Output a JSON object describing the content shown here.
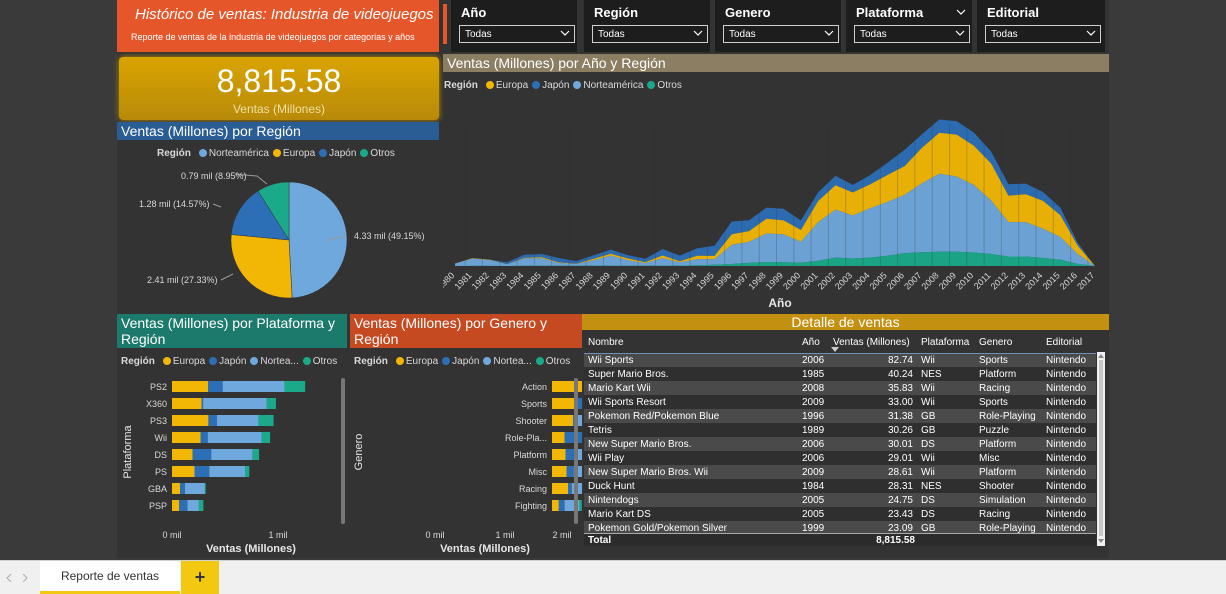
{
  "header": {
    "title": "Histórico de ventas: Industria de videojuegos",
    "subtitle": "Reporte de ventas de la industria de videojuegos por categorias y años"
  },
  "kpi": {
    "value": "8,815.58",
    "label": "Ventas (Millones)"
  },
  "slicers": [
    {
      "label": "Año",
      "value": "Todas"
    },
    {
      "label": "Región",
      "value": "Todas"
    },
    {
      "label": "Genero",
      "value": "Todas"
    },
    {
      "label": "Plataforma",
      "value": "Todas"
    },
    {
      "label": "Editorial",
      "value": "Todas"
    }
  ],
  "colors": {
    "Europa": "#f2b705",
    "Japón": "#2c6fb7",
    "Norteamérica": "#6fa8dc",
    "Otros": "#1aaa8a"
  },
  "pie": {
    "title": "Ventas (Millones) por Región",
    "legend_title": "Región",
    "legend": [
      "Norteamérica",
      "Europa",
      "Japón",
      "Otros"
    ],
    "labels": [
      "4.33 mil (49.15%)",
      "2.41 mil (27.33%)",
      "1.28 mil (14.57%)",
      "0.79 mil (8.95%)"
    ]
  },
  "area": {
    "title": "Ventas (Millones) por Año y Región",
    "legend_title": "Región",
    "legend": [
      "Europa",
      "Japón",
      "Norteamérica",
      "Otros"
    ],
    "xlabel": "Año"
  },
  "platform": {
    "title": "Ventas (Millones) por Plataforma y Región",
    "legend_title": "Región",
    "legend": [
      "Europa",
      "Japón",
      "Nortea...",
      "Otros"
    ],
    "ylabel": "Plataforma",
    "xlabel": "Ventas (Millones)",
    "ticks": [
      "0 mil",
      "1 mil"
    ]
  },
  "genre": {
    "title": "Ventas (Millones) por Genero y Región",
    "legend_title": "Región",
    "legend": [
      "Europa",
      "Japón",
      "Nortea...",
      "Otros"
    ],
    "ylabel": "Genero",
    "xlabel": "Ventas (Millones)",
    "ticks": [
      "0 mil",
      "1 mil",
      "2 mil"
    ]
  },
  "detail": {
    "title": "Detalle de ventas",
    "columns": [
      "Nombre",
      "Año",
      "Ventas (Millones)",
      "Plataforma",
      "Genero",
      "Editorial"
    ],
    "rows": [
      [
        "Wii Sports",
        "2006",
        "82.74",
        "Wii",
        "Sports",
        "Nintendo"
      ],
      [
        "Super Mario Bros.",
        "1985",
        "40.24",
        "NES",
        "Platform",
        "Nintendo"
      ],
      [
        "Mario Kart Wii",
        "2008",
        "35.83",
        "Wii",
        "Racing",
        "Nintendo"
      ],
      [
        "Wii Sports Resort",
        "2009",
        "33.00",
        "Wii",
        "Sports",
        "Nintendo"
      ],
      [
        "Pokemon Red/Pokemon Blue",
        "1996",
        "31.38",
        "GB",
        "Role-Playing",
        "Nintendo"
      ],
      [
        "Tetris",
        "1989",
        "30.26",
        "GB",
        "Puzzle",
        "Nintendo"
      ],
      [
        "New Super Mario Bros.",
        "2006",
        "30.01",
        "DS",
        "Platform",
        "Nintendo"
      ],
      [
        "Wii Play",
        "2006",
        "29.01",
        "Wii",
        "Misc",
        "Nintendo"
      ],
      [
        "New Super Mario Bros. Wii",
        "2009",
        "28.61",
        "Wii",
        "Platform",
        "Nintendo"
      ],
      [
        "Duck Hunt",
        "1984",
        "28.31",
        "NES",
        "Shooter",
        "Nintendo"
      ],
      [
        "Nintendogs",
        "2005",
        "24.75",
        "DS",
        "Simulation",
        "Nintendo"
      ],
      [
        "Mario Kart DS",
        "2005",
        "23.43",
        "DS",
        "Racing",
        "Nintendo"
      ],
      [
        "Pokemon Gold/Pokemon Silver",
        "1999",
        "23.09",
        "GB",
        "Role-Playing",
        "Nintendo"
      ]
    ],
    "total_label": "Total",
    "total_value": "8,815.58"
  },
  "tabs": {
    "active": "Reporte de ventas",
    "add": "+"
  },
  "chart_data": [
    {
      "type": "pie",
      "title": "Ventas (Millones) por Región",
      "categories": [
        "Norteamérica",
        "Europa",
        "Japón",
        "Otros"
      ],
      "values": [
        4330,
        2410,
        1280,
        790
      ],
      "percent": [
        49.15,
        27.33,
        14.57,
        8.95
      ]
    },
    {
      "type": "area",
      "title": "Ventas (Millones) por Año y Región",
      "xlabel": "Año",
      "x": [
        "1980",
        "1981",
        "1982",
        "1983",
        "1984",
        "1985",
        "1986",
        "1987",
        "1988",
        "1989",
        "1990",
        "1991",
        "1992",
        "1993",
        "1994",
        "1995",
        "1996",
        "1997",
        "1998",
        "1999",
        "2000",
        "2001",
        "2002",
        "2003",
        "2004",
        "2005",
        "2006",
        "2007",
        "2008",
        "2009",
        "2010",
        "2011",
        "2012",
        "2013",
        "2014",
        "2015",
        "2016",
        "2017"
      ],
      "series": [
        {
          "name": "Otros",
          "values": [
            0.1,
            0.4,
            0.3,
            0.1,
            0.9,
            1.0,
            1.0,
            0.5,
            1.6,
            1.5,
            0.8,
            0.8,
            1.6,
            1.7,
            3.0,
            6.0,
            9.0,
            14.0,
            18.0,
            16.5,
            15.0,
            24.0,
            38.0,
            34.0,
            38.0,
            46.0,
            58.0,
            62.0,
            64.0,
            64.5,
            61.0,
            54.0,
            43.0,
            43.0,
            36.0,
            28.0,
            9.5,
            0.1
          ]
        },
        {
          "name": "Norteamérica",
          "values": [
            10.6,
            33.4,
            26.9,
            7.8,
            33.3,
            33.7,
            12.5,
            8.5,
            23.9,
            45.2,
            25.5,
            12.8,
            33.9,
            15.1,
            28.2,
            24.8,
            86.8,
            94.8,
            128.4,
            126.1,
            94.5,
            173.9,
            216.2,
            193.6,
            222.6,
            242.6,
            263.1,
            311.2,
            351.4,
            338.9,
            304.2,
            241.1,
            154.9,
            154.8,
            131.9,
            102.8,
            44.9,
            0.0
          ]
        },
        {
          "name": "Europa",
          "values": [
            0.7,
            2.0,
            1.7,
            0.8,
            2.1,
            4.7,
            2.8,
            1.4,
            6.6,
            8.4,
            7.6,
            4.0,
            11.7,
            4.7,
            14.9,
            14.9,
            47.3,
            48.3,
            66.9,
            62.7,
            52.8,
            94.9,
            109.7,
            103.8,
            107.3,
            121.6,
            129.2,
            160.2,
            184.4,
            188.7,
            177.1,
            166.5,
            118.8,
            125.8,
            125.7,
            97.7,
            36.6,
            0.0
          ]
        },
        {
          "name": "Japón",
          "values": [
            0.0,
            0.0,
            0.0,
            8.1,
            14.3,
            14.6,
            19.8,
            11.6,
            15.8,
            18.4,
            14.9,
            14.8,
            28.9,
            25.3,
            33.9,
            45.8,
            57.4,
            48.9,
            50.0,
            52.3,
            42.8,
            39.9,
            42.0,
            34.2,
            41.7,
            54.3,
            73.7,
            60.3,
            60.3,
            61.0,
            59.5,
            53.0,
            51.8,
            47.6,
            39.5,
            33.7,
            13.7,
            0.1
          ]
        }
      ]
    },
    {
      "type": "bar",
      "title": "Ventas (Millones) por Plataforma y Región",
      "orientation": "horizontal",
      "stacked": true,
      "categories": [
        "PS2",
        "X360",
        "PS3",
        "Wii",
        "DS",
        "PS",
        "GBA",
        "PSP"
      ],
      "series": [
        {
          "name": "Europa",
          "values": [
            339.3,
            280.6,
            343.7,
            268.4,
            194.6,
            212.4,
            75.3,
            68.3
          ]
        },
        {
          "name": "Japón",
          "values": [
            139.2,
            12.4,
            79.9,
            69.4,
            175.6,
            139.8,
            47.3,
            76.8
          ]
        },
        {
          "name": "Norteamérica",
          "values": [
            583.8,
            601.1,
            393.5,
            507.7,
            390.7,
            336.5,
            187.5,
            108.9
          ]
        },
        {
          "name": "Otros",
          "values": [
            193.4,
            85.5,
            141.9,
            80.6,
            60.5,
            40.9,
            7.7,
            42.2
          ]
        }
      ],
      "xlim": [
        0,
        1350
      ],
      "xticks": [
        "0 mil",
        "1 mil"
      ]
    },
    {
      "type": "bar",
      "title": "Ventas (Millones) por Genero y Región",
      "orientation": "horizontal",
      "stacked": true,
      "categories": [
        "Action",
        "Sports",
        "Shooter",
        "Role-Pla...",
        "Platform",
        "Misc",
        "Racing",
        "Fighting"
      ],
      "series": [
        {
          "name": "Europa",
          "values": [
            525.0,
            376.9,
            313.3,
            187.6,
            201.6,
            215.9,
            238.4,
            101.3
          ]
        },
        {
          "name": "Japón",
          "values": [
            159.9,
            135.4,
            38.3,
            352.3,
            130.8,
            107.8,
            56.7,
            87.4
          ]
        },
        {
          "name": "Norteamérica",
          "values": [
            877.8,
            683.4,
            582.6,
            327.3,
            447.1,
            410.2,
            359.4,
            220.4
          ]
        },
        {
          "name": "Otros",
          "values": [
            187.4,
            134.0,
            102.7,
            59.6,
            51.6,
            75.3,
            77.3,
            36.2
          ]
        }
      ],
      "xlim": [
        0,
        2200
      ],
      "xticks": [
        "0 mil",
        "1 mil",
        "2 mil"
      ]
    }
  ]
}
